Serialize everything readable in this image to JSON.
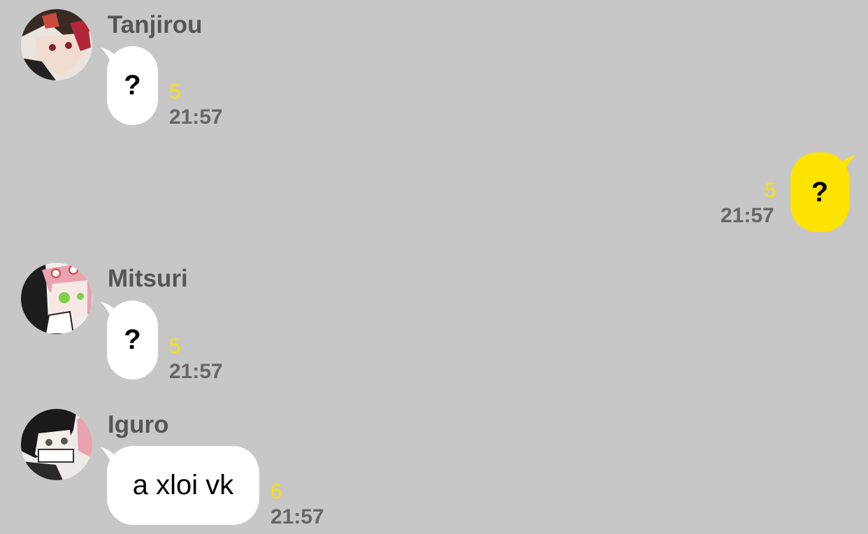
{
  "colors": {
    "background": "#c7c7c7",
    "incoming_bubble": "#ffffff",
    "outgoing_bubble": "#fde300",
    "unread_count": "#f7e100"
  },
  "messages": [
    {
      "sender": "Tanjirou",
      "avatar_icon": "tanjirou-avatar",
      "text": "?",
      "unread": "5",
      "time": "21:57"
    },
    {
      "sender": "",
      "text": "?",
      "unread": "5",
      "time": "21:57"
    },
    {
      "sender": "Mitsuri",
      "avatar_icon": "mitsuri-avatar",
      "text": "?",
      "unread": "5",
      "time": "21:57"
    },
    {
      "sender": "Iguro",
      "avatar_icon": "iguro-avatar",
      "text": "a xloi vk",
      "unread": "6",
      "time": "21:57"
    }
  ]
}
